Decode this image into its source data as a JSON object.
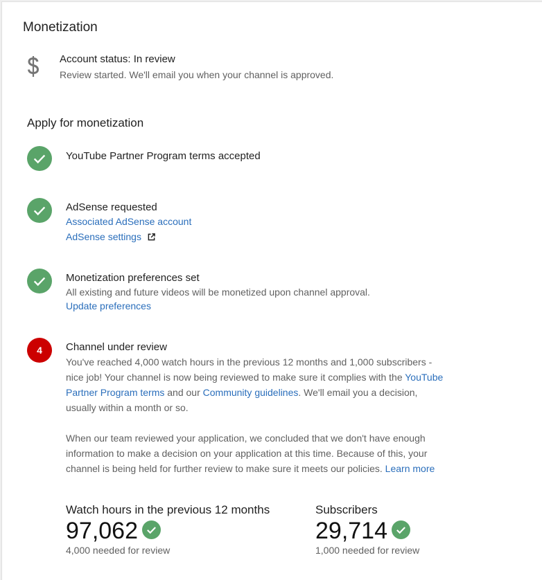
{
  "section": {
    "title": "Monetization"
  },
  "account": {
    "icon": "dollar-icon",
    "status": "Account status: In review",
    "detail": "Review started. We'll email you when your channel is approved."
  },
  "apply": {
    "title": "Apply for monetization",
    "steps": [
      {
        "state": "done",
        "icon": "check-icon",
        "title": "YouTube Partner Program terms accepted"
      },
      {
        "state": "done",
        "icon": "check-icon",
        "title": "AdSense requested",
        "link1": "Associated AdSense account",
        "link2": "AdSense settings",
        "link2_icon": "external-link-icon"
      },
      {
        "state": "done",
        "icon": "check-icon",
        "title": "Monetization preferences set",
        "detail": "All existing and future videos will be monetized upon channel approval.",
        "link": "Update preferences"
      },
      {
        "state": "current",
        "number": "4",
        "title": "Channel under review",
        "p1_a": "You've reached 4,000 watch hours in the previous 12 months and 1,000 subscribers - nice job! Your channel is now being reviewed to make sure it complies with the ",
        "p1_link1": "YouTube Partner Program terms",
        "p1_b": " and our ",
        "p1_link2": "Community guidelines",
        "p1_c": ". We'll email you a decision, usually within a month or so.",
        "p2_a": "When our team reviewed your application, we concluded that we don't have enough information to make a decision on your application at this time. Because of this, your channel is being held for further review to make sure it meets our policies. ",
        "p2_link": "Learn more"
      }
    ]
  },
  "metrics": {
    "watch_hours": {
      "label": "Watch hours in the previous 12 months",
      "value": "97,062",
      "note": "4,000 needed for review"
    },
    "subscribers": {
      "label": "Subscribers",
      "value": "29,714",
      "note": "1,000 needed for review"
    }
  },
  "colors": {
    "success": "#5aa469",
    "alert": "#cc0000",
    "link": "#2a6ebb"
  }
}
